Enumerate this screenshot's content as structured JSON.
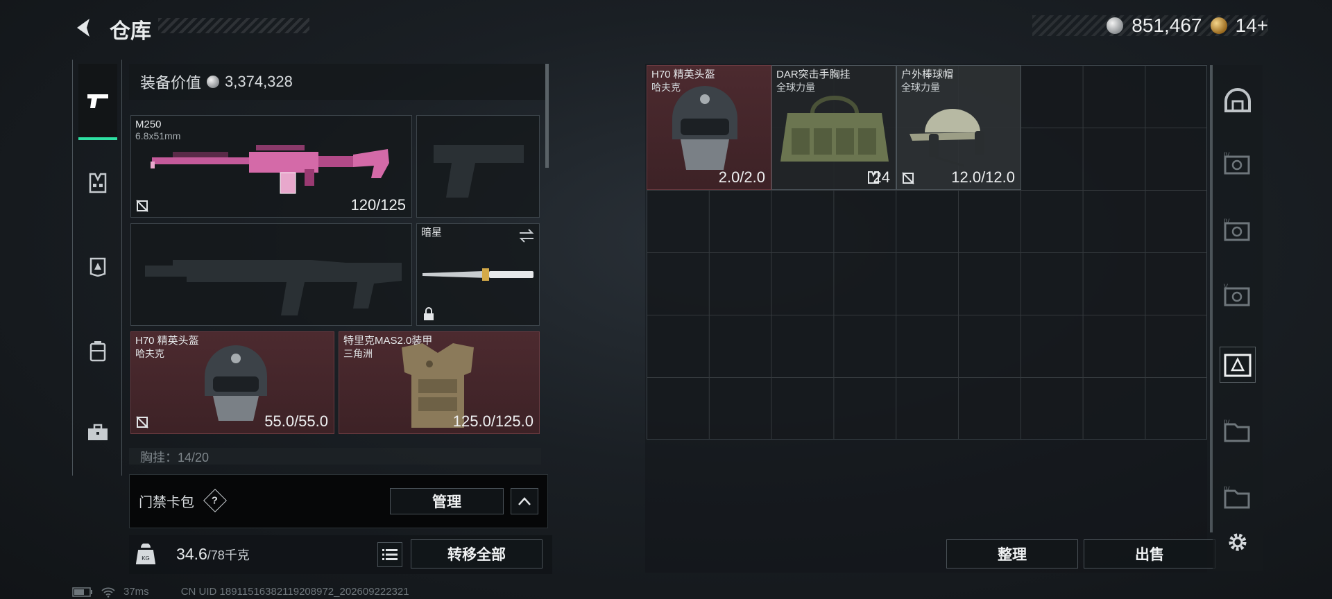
{
  "header": {
    "title": "仓库"
  },
  "currency": {
    "silver": "851,467",
    "gold": "14+"
  },
  "equipment": {
    "value_label": "装备价值",
    "value": "3,374,328",
    "primary": {
      "name": "M250",
      "caliber": "6.8x51mm",
      "durability": "120/125"
    },
    "melee": {
      "name": "暗星"
    },
    "helmet": {
      "name": "H70 精英头盔",
      "faction": "哈夫克",
      "durability": "55.0/55.0"
    },
    "armor": {
      "name": "特里克MAS2.0装甲",
      "faction": "三角洲",
      "durability": "125.0/125.0"
    },
    "chest_rig_partial": "胸挂：14/20"
  },
  "keycard": {
    "label": "门禁卡包",
    "help": "?",
    "manage_label": "管理"
  },
  "weight": {
    "current": "34.6",
    "max": "/78千克",
    "transfer_label": "转移全部"
  },
  "status": {
    "ping": "37ms",
    "uid": "CN UID 18911516382119208972_202609222321"
  },
  "stash": {
    "items": [
      {
        "name": "H70 精英头盔",
        "faction": "哈夫克",
        "value": "2.0/2.0"
      },
      {
        "name": "DAR突击手胸挂",
        "faction": "全球力量",
        "value": "24"
      },
      {
        "name": "户外棒球帽",
        "faction": "全球力量",
        "value": "12.0/12.0"
      }
    ],
    "sort_label": "整理",
    "sell_label": "出售"
  },
  "colors": {
    "accent": "#2ee0a3",
    "red_slot": "#4c2a2f"
  }
}
